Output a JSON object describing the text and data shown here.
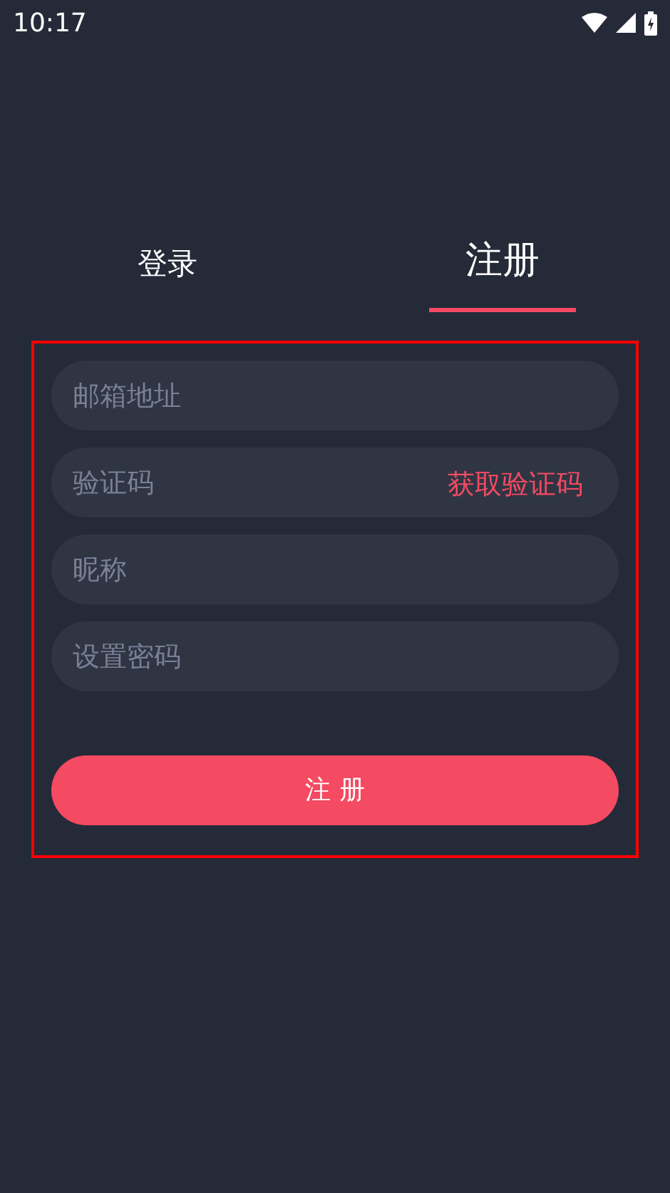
{
  "status_bar": {
    "time": "10:17"
  },
  "tabs": [
    {
      "label": "登录",
      "selected": false
    },
    {
      "label": "注册",
      "selected": true
    }
  ],
  "fields": [
    {
      "placeholder": "邮箱地址"
    },
    {
      "placeholder": "验证码",
      "action": "获取验证码"
    },
    {
      "placeholder": "昵称"
    },
    {
      "placeholder": "设置密码"
    }
  ],
  "submit_button": "注 册"
}
